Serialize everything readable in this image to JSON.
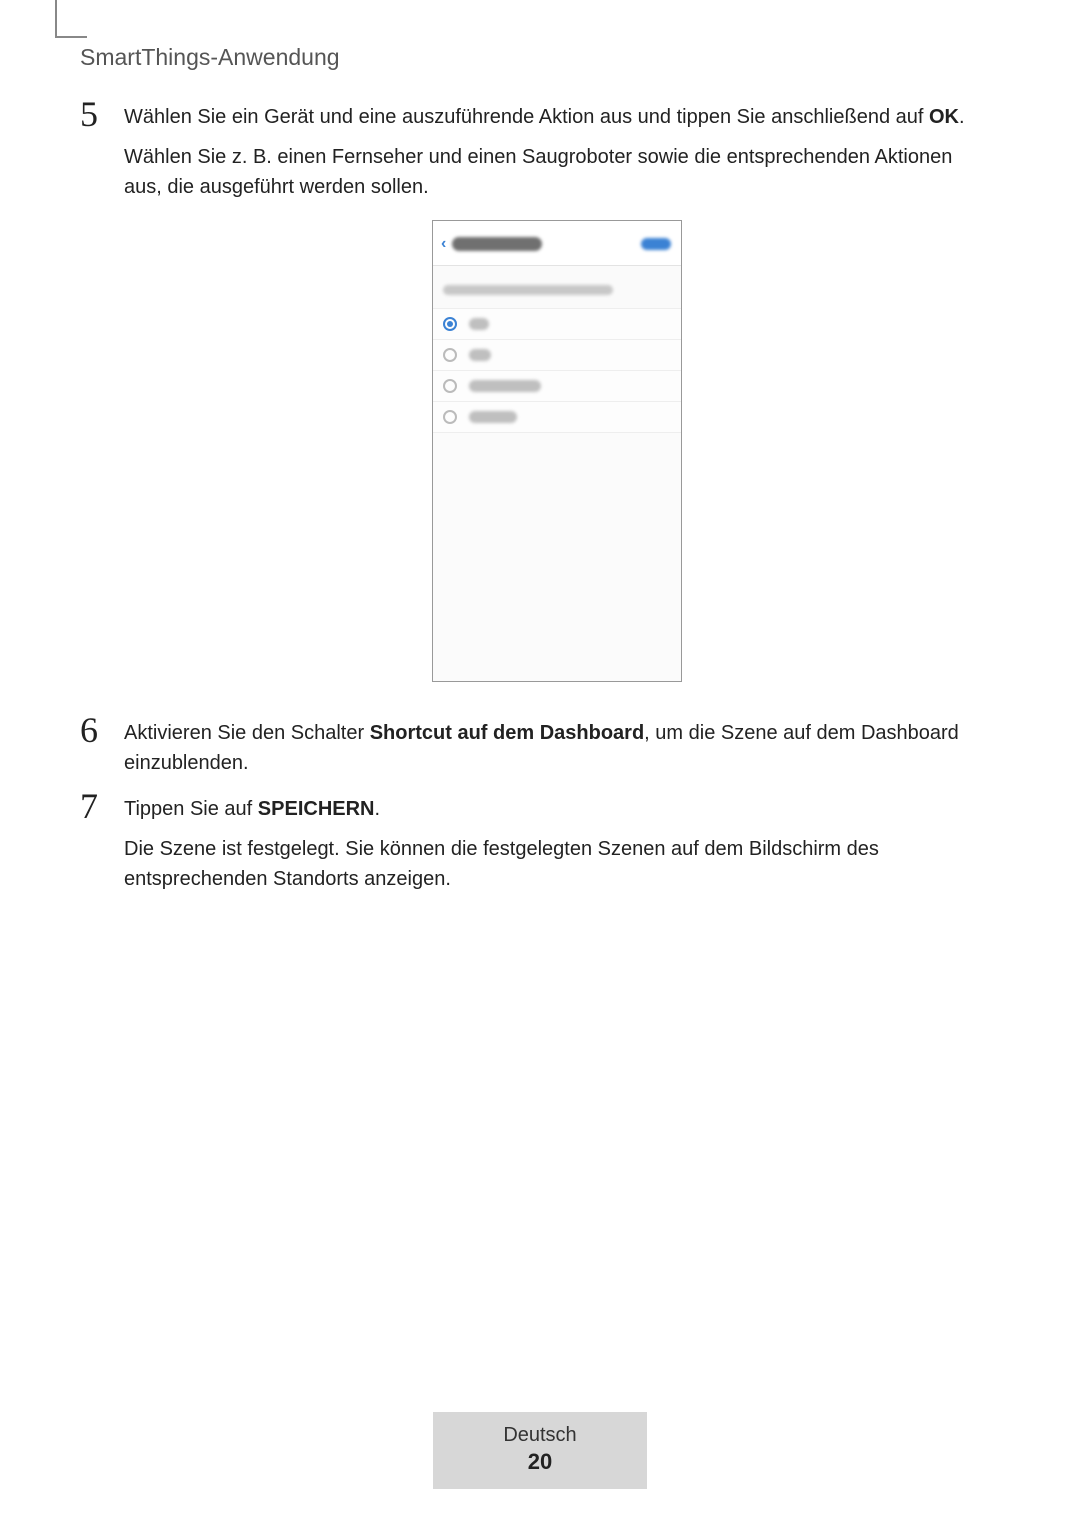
{
  "header": {
    "section_title": "SmartThings-Anwendung"
  },
  "steps": {
    "s5": {
      "num": "5",
      "p1_pre": "Wählen Sie ein Gerät und eine auszuführende Aktion aus und tippen Sie anschließend auf ",
      "p1_bold": "OK",
      "p1_post": ".",
      "p2": "Wählen Sie z. B. einen Fernseher und einen Saugroboter sowie die entsprechenden Aktionen aus, die ausgeführt werden sollen."
    },
    "s6": {
      "num": "6",
      "p1_pre": "Aktivieren Sie den Schalter ",
      "p1_bold": "Shortcut auf dem Dashboard",
      "p1_post": ", um die Szene auf dem Dashboard einzublenden."
    },
    "s7": {
      "num": "7",
      "p1_pre": "Tippen Sie auf ",
      "p1_bold": "SPEICHERN",
      "p1_post": ".",
      "p2": "Die Szene ist festgelegt. Sie können die festgelegten Szenen auf dem Bildschirm des entsprechenden Standorts anzeigen."
    }
  },
  "footer": {
    "language": "Deutsch",
    "page": "20"
  }
}
